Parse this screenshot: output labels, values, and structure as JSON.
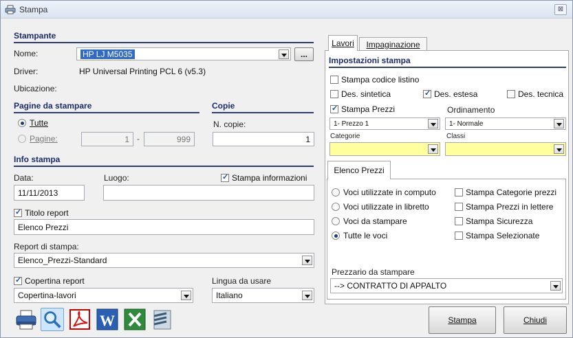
{
  "window": {
    "title": "Stampa",
    "close_symbol": "⊠"
  },
  "stampante": {
    "section_title": "Stampante",
    "nome_label": "Nome:",
    "nome_value": "HP LJ M5035",
    "browse_label": "...",
    "driver_label": "Driver:",
    "driver_value": "HP Universal Printing PCL 6 (v5.3)",
    "ubicazione_label": "Ubicazione:"
  },
  "pagine": {
    "section_title": "Pagine da stampare",
    "tutte_label": "Tutte",
    "pagine_label": "Pagine:",
    "from": "1",
    "separator": "-",
    "to": "999",
    "selected": "Tutte"
  },
  "copie": {
    "section_title": "Copie",
    "label": "N. copie:",
    "value": "1"
  },
  "info": {
    "section_title": "Info stampa",
    "data_label": "Data:",
    "data_value": "11/11/2013",
    "luogo_label": "Luogo:",
    "luogo_value": "",
    "stampa_informazioni_label": "Stampa informazioni",
    "stampa_informazioni_checked": true,
    "titolo_label": "Titolo report",
    "titolo_checked": true,
    "titolo_value": "Elenco Prezzi",
    "report_label": "Report di stampa:",
    "report_value": "Elenco_Prezzi-Standard",
    "copertina_label": "Copertina report",
    "copertina_checked": true,
    "copertina_value": "Copertina-lavori",
    "lingua_label": "Lingua da usare",
    "lingua_value": "Italiano"
  },
  "tabs": {
    "lavori": "Lavori",
    "impaginazione": "Impaginazione",
    "active": "Lavori"
  },
  "impostazioni": {
    "section_title": "Impostazioni stampa",
    "codice_listino_label": "Stampa codice listino",
    "codice_listino_checked": false,
    "des_sintetica_label": "Des. sintetica",
    "des_sintetica_checked": false,
    "des_estesa_label": "Des. estesa",
    "des_estesa_checked": true,
    "des_tecnica_label": "Des. tecnica",
    "des_tecnica_checked": false,
    "stampa_prezzi_label": "Stampa Prezzi",
    "stampa_prezzi_checked": true,
    "ordinamento_label": "Ordinamento",
    "prezzo_value": "1- Prezzo 1",
    "ordinamento_value": "1- Normale",
    "categorie_label": "Categorie",
    "classi_label": "Classi"
  },
  "elenco": {
    "tab_label": "Elenco Prezzi",
    "radio_options": [
      "Voci utilizzate in computo",
      "Voci utilizzate in libretto",
      "Voci da stampare",
      "Tutte le voci"
    ],
    "radio_selected": "Tutte le voci",
    "checks": [
      {
        "label": "Stampa Categorie prezzi",
        "checked": false
      },
      {
        "label": "Stampa Prezzi in lettere",
        "checked": false
      },
      {
        "label": "Stampa Sicurezza",
        "checked": false
      },
      {
        "label": "Stampa Selezionate",
        "checked": false
      }
    ],
    "prezzario_label": "Prezzario da stampare",
    "prezzario_value": "--> CONTRATTO DI APPALTO"
  },
  "buttons": {
    "stampa": "Stampa",
    "chiudi": "Chiudi"
  },
  "toolbar": [
    "printer-icon",
    "preview-icon",
    "pdf-icon",
    "word-icon",
    "excel-icon",
    "export-icon"
  ],
  "colors": {
    "section": "#1c2c6a",
    "selection": "#316ac5",
    "yellow_field": "#ffff9e"
  }
}
